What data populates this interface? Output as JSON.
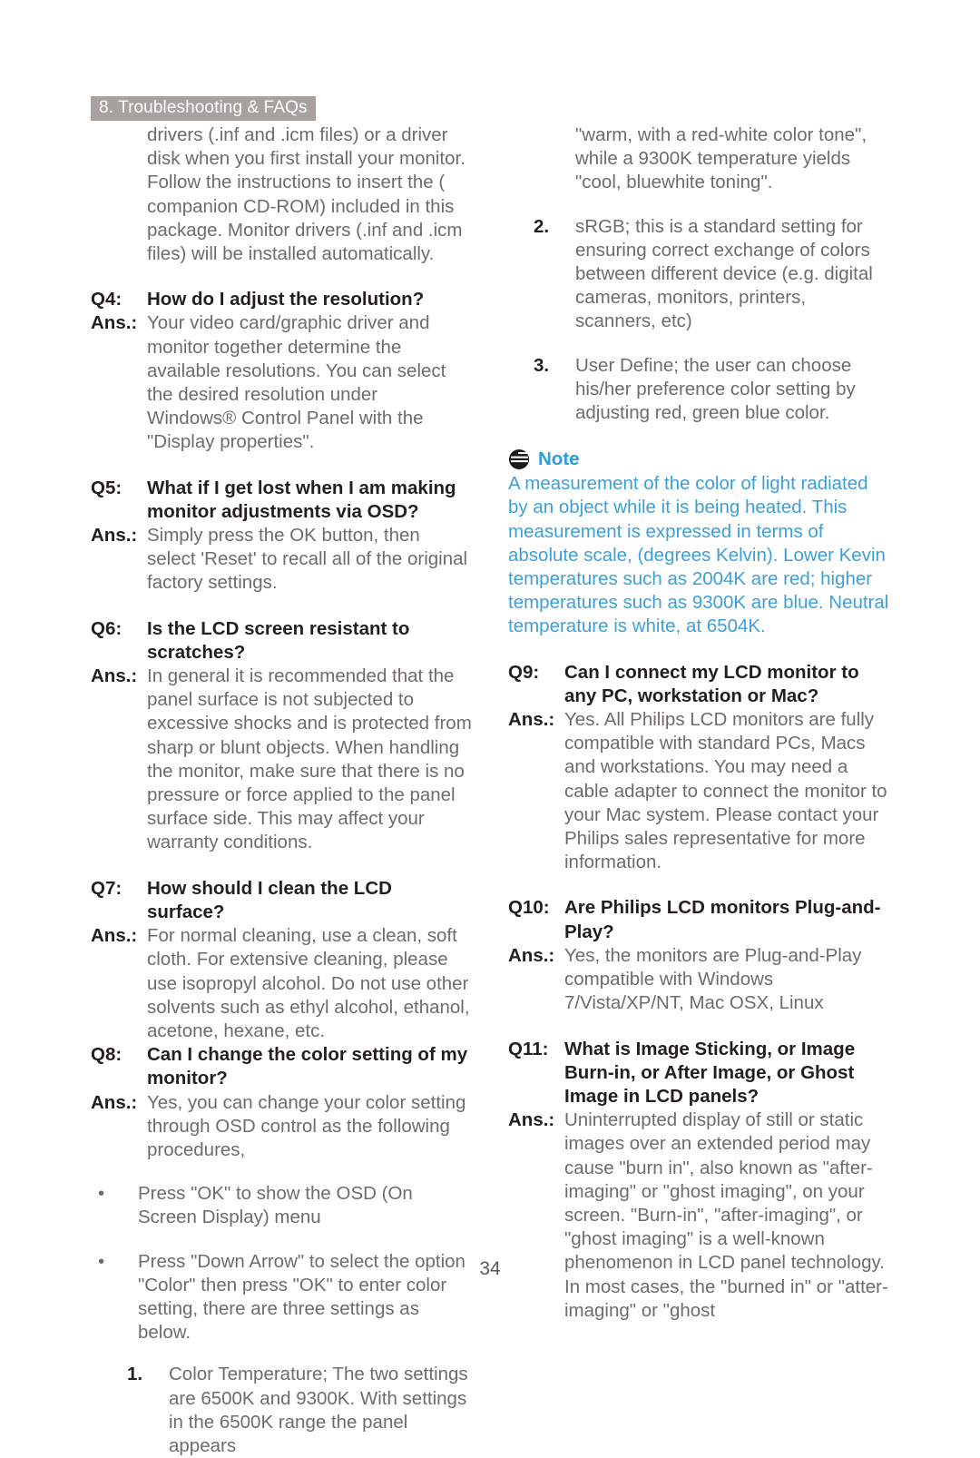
{
  "header": {
    "banner_label": "8. Troubleshooting & FAQs"
  },
  "footer": {
    "page_number": "34"
  },
  "colors": {
    "banner_background": "#a9a19e",
    "banner_text": "#ffffff",
    "body_text": "#6f6b6b",
    "heading_text": "#231f20",
    "note_accent": "#2f9dd6",
    "note_body": "#3d9fd8"
  },
  "left_column": {
    "intro_continuation": "drivers (.inf and .icm files) or a driver disk when you first install your monitor. Follow the instructions to insert the ( companion CD-ROM) included in this package. Monitor drivers (.inf and .icm files) will be installed automatically.",
    "faqs": [
      {
        "q_label": "Q4:",
        "question": "How do I adjust the resolution?",
        "a_label": "Ans.:",
        "answer": "Your video card/graphic driver and monitor together determine the available resolutions. You can select the desired resolution under Windows® Control Panel with the \"Display properties\"."
      },
      {
        "q_label": "Q5:",
        "question": "What if I get lost when I am making monitor adjustments via OSD?",
        "a_label": "Ans.:",
        "answer": "Simply press the OK button, then select 'Reset' to recall all of the original factory settings."
      },
      {
        "q_label": "Q6:",
        "question": "Is the LCD screen resistant to scratches?",
        "a_label": "Ans.:",
        "answer": "In general it is recommended that the panel surface is not subjected to excessive shocks and is protected from sharp or blunt objects. When handling the monitor, make sure that there is no pressure or force applied to the panel surface side. This may affect your warranty conditions."
      },
      {
        "q_label": "Q7:",
        "question": "How should I clean the LCD surface?",
        "a_label": "Ans.:",
        "answer": "For normal cleaning, use a clean, soft cloth. For extensive cleaning, please use isopropyl alcohol. Do not use other solvents such as ethyl alcohol, ethanol, acetone, hexane, etc."
      },
      {
        "q_label": "Q8:",
        "question": "Can I change the color setting of my monitor?",
        "a_label": "Ans.:",
        "answer": "Yes, you can change your color setting through OSD control as the following procedures,"
      }
    ],
    "bullets": [
      {
        "mark": "•",
        "text": "Press \"OK\" to show the OSD (On Screen Display) menu"
      },
      {
        "mark": "•",
        "text": "Press \"Down Arrow\" to select the option \"Color\" then press \"OK\" to enter color setting, there are three settings as below."
      }
    ],
    "numbered_item": {
      "mark": "1.",
      "text": "Color Temperature; The two settings are 6500K and 9300K. With settings in the 6500K range the panel appears"
    }
  },
  "right_column": {
    "item_one_continuation": "\"warm, with a red-white color tone\", while a 9300K temperature yields \"cool, bluewhite toning\".",
    "numbered_items": [
      {
        "mark": "2.",
        "text": "sRGB; this is a standard setting for ensuring correct exchange of colors between different device (e.g. digital cameras, monitors, printers, scanners, etc)"
      },
      {
        "mark": "3.",
        "text": "User Define; the user can choose his/her preference color setting by adjusting red, green blue color."
      }
    ],
    "note": {
      "icon": "note-icon",
      "title": "Note",
      "body": "A measurement of the color of light radiated by an object while it is being heated. This measurement is expressed in terms of absolute scale, (degrees Kelvin). Lower Kevin temperatures such as 2004K are red; higher temperatures such as 9300K are blue. Neutral temperature is white, at 6504K."
    },
    "faqs": [
      {
        "q_label": "Q9:",
        "question": "Can I connect my LCD monitor to any PC, workstation or Mac?",
        "a_label": "Ans.:",
        "answer": "Yes. All Philips LCD monitors are fully compatible with standard PCs, Macs and workstations. You may need a cable adapter to connect the monitor to your Mac system. Please contact your Philips sales representative for more information."
      },
      {
        "q_label": "Q10:",
        "question": "Are Philips LCD monitors Plug-and-Play?",
        "a_label": "Ans.:",
        "answer": "Yes, the monitors are Plug-and-Play compatible with Windows 7/Vista/XP/NT, Mac OSX, Linux"
      },
      {
        "q_label": "Q11:",
        "question": "What is Image Sticking, or Image Burn-in, or After Image, or Ghost Image in LCD panels?",
        "a_label": "Ans.:",
        "answer": "Uninterrupted display of still or static images over an extended period may cause \"burn in\", also known as \"after-imaging\" or \"ghost imaging\", on your screen. \"Burn-in\", \"after-imaging\", or \"ghost imaging\" is a well-known phenomenon in LCD panel technology. In most cases, the \"burned in\" or \"atter-imaging\" or \"ghost"
      }
    ]
  }
}
